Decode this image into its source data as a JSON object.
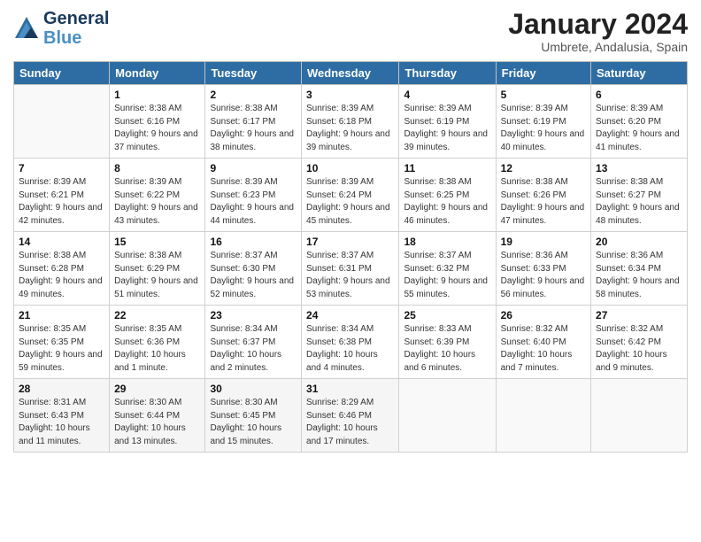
{
  "header": {
    "logo_line1": "General",
    "logo_line2": "Blue",
    "month_title": "January 2024",
    "subtitle": "Umbrete, Andalusia, Spain"
  },
  "weekdays": [
    "Sunday",
    "Monday",
    "Tuesday",
    "Wednesday",
    "Thursday",
    "Friday",
    "Saturday"
  ],
  "weeks": [
    [
      {
        "day": "",
        "sunrise": "",
        "sunset": "",
        "daylight": ""
      },
      {
        "day": "1",
        "sunrise": "Sunrise: 8:38 AM",
        "sunset": "Sunset: 6:16 PM",
        "daylight": "Daylight: 9 hours and 37 minutes."
      },
      {
        "day": "2",
        "sunrise": "Sunrise: 8:38 AM",
        "sunset": "Sunset: 6:17 PM",
        "daylight": "Daylight: 9 hours and 38 minutes."
      },
      {
        "day": "3",
        "sunrise": "Sunrise: 8:39 AM",
        "sunset": "Sunset: 6:18 PM",
        "daylight": "Daylight: 9 hours and 39 minutes."
      },
      {
        "day": "4",
        "sunrise": "Sunrise: 8:39 AM",
        "sunset": "Sunset: 6:19 PM",
        "daylight": "Daylight: 9 hours and 39 minutes."
      },
      {
        "day": "5",
        "sunrise": "Sunrise: 8:39 AM",
        "sunset": "Sunset: 6:19 PM",
        "daylight": "Daylight: 9 hours and 40 minutes."
      },
      {
        "day": "6",
        "sunrise": "Sunrise: 8:39 AM",
        "sunset": "Sunset: 6:20 PM",
        "daylight": "Daylight: 9 hours and 41 minutes."
      }
    ],
    [
      {
        "day": "7",
        "sunrise": "Sunrise: 8:39 AM",
        "sunset": "Sunset: 6:21 PM",
        "daylight": "Daylight: 9 hours and 42 minutes."
      },
      {
        "day": "8",
        "sunrise": "Sunrise: 8:39 AM",
        "sunset": "Sunset: 6:22 PM",
        "daylight": "Daylight: 9 hours and 43 minutes."
      },
      {
        "day": "9",
        "sunrise": "Sunrise: 8:39 AM",
        "sunset": "Sunset: 6:23 PM",
        "daylight": "Daylight: 9 hours and 44 minutes."
      },
      {
        "day": "10",
        "sunrise": "Sunrise: 8:39 AM",
        "sunset": "Sunset: 6:24 PM",
        "daylight": "Daylight: 9 hours and 45 minutes."
      },
      {
        "day": "11",
        "sunrise": "Sunrise: 8:38 AM",
        "sunset": "Sunset: 6:25 PM",
        "daylight": "Daylight: 9 hours and 46 minutes."
      },
      {
        "day": "12",
        "sunrise": "Sunrise: 8:38 AM",
        "sunset": "Sunset: 6:26 PM",
        "daylight": "Daylight: 9 hours and 47 minutes."
      },
      {
        "day": "13",
        "sunrise": "Sunrise: 8:38 AM",
        "sunset": "Sunset: 6:27 PM",
        "daylight": "Daylight: 9 hours and 48 minutes."
      }
    ],
    [
      {
        "day": "14",
        "sunrise": "Sunrise: 8:38 AM",
        "sunset": "Sunset: 6:28 PM",
        "daylight": "Daylight: 9 hours and 49 minutes."
      },
      {
        "day": "15",
        "sunrise": "Sunrise: 8:38 AM",
        "sunset": "Sunset: 6:29 PM",
        "daylight": "Daylight: 9 hours and 51 minutes."
      },
      {
        "day": "16",
        "sunrise": "Sunrise: 8:37 AM",
        "sunset": "Sunset: 6:30 PM",
        "daylight": "Daylight: 9 hours and 52 minutes."
      },
      {
        "day": "17",
        "sunrise": "Sunrise: 8:37 AM",
        "sunset": "Sunset: 6:31 PM",
        "daylight": "Daylight: 9 hours and 53 minutes."
      },
      {
        "day": "18",
        "sunrise": "Sunrise: 8:37 AM",
        "sunset": "Sunset: 6:32 PM",
        "daylight": "Daylight: 9 hours and 55 minutes."
      },
      {
        "day": "19",
        "sunrise": "Sunrise: 8:36 AM",
        "sunset": "Sunset: 6:33 PM",
        "daylight": "Daylight: 9 hours and 56 minutes."
      },
      {
        "day": "20",
        "sunrise": "Sunrise: 8:36 AM",
        "sunset": "Sunset: 6:34 PM",
        "daylight": "Daylight: 9 hours and 58 minutes."
      }
    ],
    [
      {
        "day": "21",
        "sunrise": "Sunrise: 8:35 AM",
        "sunset": "Sunset: 6:35 PM",
        "daylight": "Daylight: 9 hours and 59 minutes."
      },
      {
        "day": "22",
        "sunrise": "Sunrise: 8:35 AM",
        "sunset": "Sunset: 6:36 PM",
        "daylight": "Daylight: 10 hours and 1 minute."
      },
      {
        "day": "23",
        "sunrise": "Sunrise: 8:34 AM",
        "sunset": "Sunset: 6:37 PM",
        "daylight": "Daylight: 10 hours and 2 minutes."
      },
      {
        "day": "24",
        "sunrise": "Sunrise: 8:34 AM",
        "sunset": "Sunset: 6:38 PM",
        "daylight": "Daylight: 10 hours and 4 minutes."
      },
      {
        "day": "25",
        "sunrise": "Sunrise: 8:33 AM",
        "sunset": "Sunset: 6:39 PM",
        "daylight": "Daylight: 10 hours and 6 minutes."
      },
      {
        "day": "26",
        "sunrise": "Sunrise: 8:32 AM",
        "sunset": "Sunset: 6:40 PM",
        "daylight": "Daylight: 10 hours and 7 minutes."
      },
      {
        "day": "27",
        "sunrise": "Sunrise: 8:32 AM",
        "sunset": "Sunset: 6:42 PM",
        "daylight": "Daylight: 10 hours and 9 minutes."
      }
    ],
    [
      {
        "day": "28",
        "sunrise": "Sunrise: 8:31 AM",
        "sunset": "Sunset: 6:43 PM",
        "daylight": "Daylight: 10 hours and 11 minutes."
      },
      {
        "day": "29",
        "sunrise": "Sunrise: 8:30 AM",
        "sunset": "Sunset: 6:44 PM",
        "daylight": "Daylight: 10 hours and 13 minutes."
      },
      {
        "day": "30",
        "sunrise": "Sunrise: 8:30 AM",
        "sunset": "Sunset: 6:45 PM",
        "daylight": "Daylight: 10 hours and 15 minutes."
      },
      {
        "day": "31",
        "sunrise": "Sunrise: 8:29 AM",
        "sunset": "Sunset: 6:46 PM",
        "daylight": "Daylight: 10 hours and 17 minutes."
      },
      {
        "day": "",
        "sunrise": "",
        "sunset": "",
        "daylight": ""
      },
      {
        "day": "",
        "sunrise": "",
        "sunset": "",
        "daylight": ""
      },
      {
        "day": "",
        "sunrise": "",
        "sunset": "",
        "daylight": ""
      }
    ]
  ]
}
